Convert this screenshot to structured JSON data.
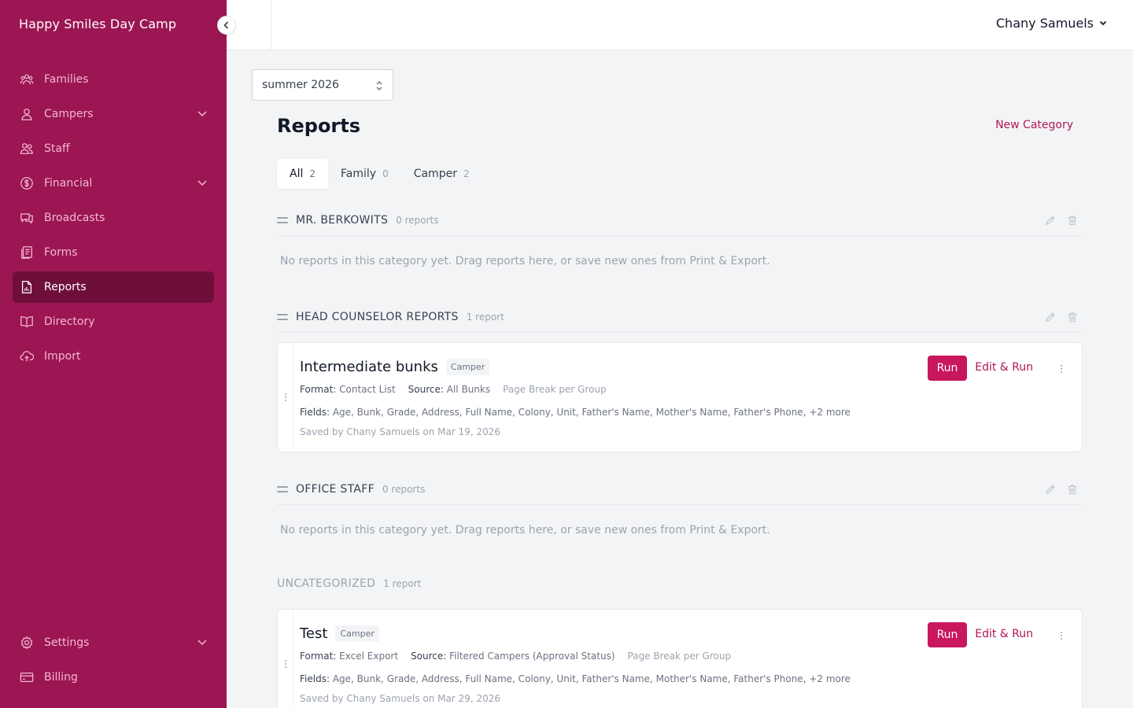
{
  "app": {
    "name": "Happy Smiles Day Camp"
  },
  "user": {
    "name": "Chany Samuels"
  },
  "sidebar": {
    "items": [
      {
        "label": "Families",
        "icon": "families-icon"
      },
      {
        "label": "Campers",
        "icon": "person-icon"
      },
      {
        "label": "Staff",
        "icon": "staff-icon"
      },
      {
        "label": "Financial",
        "icon": "dollar-icon"
      },
      {
        "label": "Broadcasts",
        "icon": "chat-icon"
      },
      {
        "label": "Forms",
        "icon": "forms-icon"
      },
      {
        "label": "Reports",
        "icon": "report-icon",
        "active": true
      },
      {
        "label": "Directory",
        "icon": "book-icon"
      },
      {
        "label": "Import",
        "icon": "cloud-upload-icon"
      }
    ],
    "bottom": [
      {
        "label": "Settings",
        "icon": "gear-icon"
      },
      {
        "label": "Billing",
        "icon": "credit-card-icon"
      }
    ]
  },
  "season": {
    "value": "summer 2026"
  },
  "page": {
    "title": "Reports",
    "new_category": "New Category"
  },
  "tabs": [
    {
      "label": "All",
      "count": "2",
      "active": true
    },
    {
      "label": "Family",
      "count": "0"
    },
    {
      "label": "Camper",
      "count": "2"
    }
  ],
  "empty_message": "No reports in this category yet. Drag reports here, or save new ones from Print & Export.",
  "categories": [
    {
      "name": "MR. BERKOWITS",
      "count": "0 reports"
    },
    {
      "name": "HEAD COUNSELOR REPORTS",
      "count": "1 report"
    },
    {
      "name": "OFFICE STAFF",
      "count": "0 reports"
    },
    {
      "name": "UNCATEGORIZED",
      "count": "1 report"
    }
  ],
  "labels": {
    "format": "Format:",
    "source": "Source:",
    "fields": "Fields:",
    "run": "Run",
    "edit_run": "Edit & Run"
  },
  "reports": [
    {
      "title": "Intermediate bunks",
      "type": "Camper",
      "format": "Contact List",
      "source": "All Bunks",
      "page_break": "Page Break per Group",
      "fields": "Age, Bunk, Grade, Address, Full Name, Colony, Unit, Father's Name, Mother's Name, Father's Phone, +2 more",
      "saved": "Saved by Chany Samuels on Mar 19, 2026"
    },
    {
      "title": "Test",
      "type": "Camper",
      "format": "Excel Export",
      "source": "Filtered Campers (Approval Status)",
      "page_break": "Page Break per Group",
      "fields": "Age, Bunk, Grade, Address, Full Name, Colony, Unit, Father's Name, Mother's Name, Father's Phone, +2 more",
      "saved": "Saved by Chany Samuels on Mar 29, 2026"
    }
  ],
  "colors": {
    "sidebar_bg": "#9b1652",
    "sidebar_active": "#6e0f3a",
    "accent": "#c8175d",
    "page_bg": "#f3f4f6"
  }
}
